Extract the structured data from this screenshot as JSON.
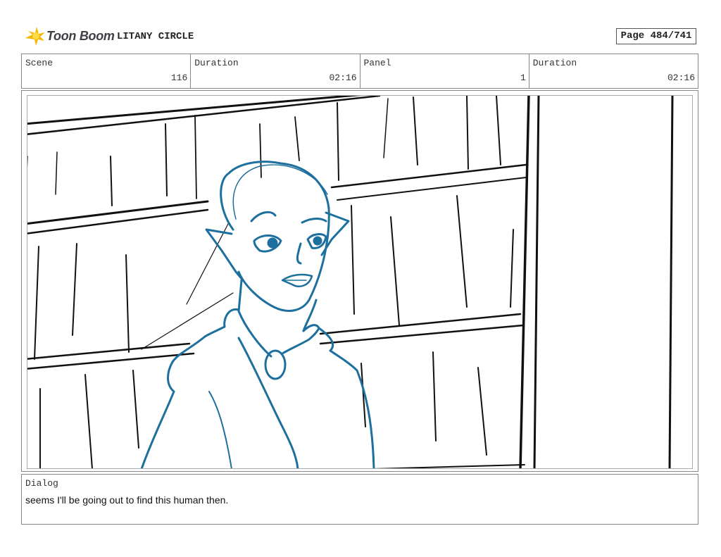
{
  "header": {
    "brand": "Toon Boom",
    "project_title": "LITANY CIRCLE",
    "page": "Page 484/741"
  },
  "info": {
    "scene_label": "Scene",
    "scene_value": "116",
    "duration_label": "Duration",
    "duration_value": "02:16",
    "panel_label": "Panel",
    "panel_value": "1",
    "panel_duration_label": "Duration",
    "panel_duration_value": "02:16"
  },
  "dialog": {
    "label": "Dialog",
    "text": "seems I'll be going out to find this human then."
  },
  "colors": {
    "sketch_black": "#111111",
    "sketch_blue": "#1d6f9e",
    "logo_yellow": "#f5b800"
  }
}
